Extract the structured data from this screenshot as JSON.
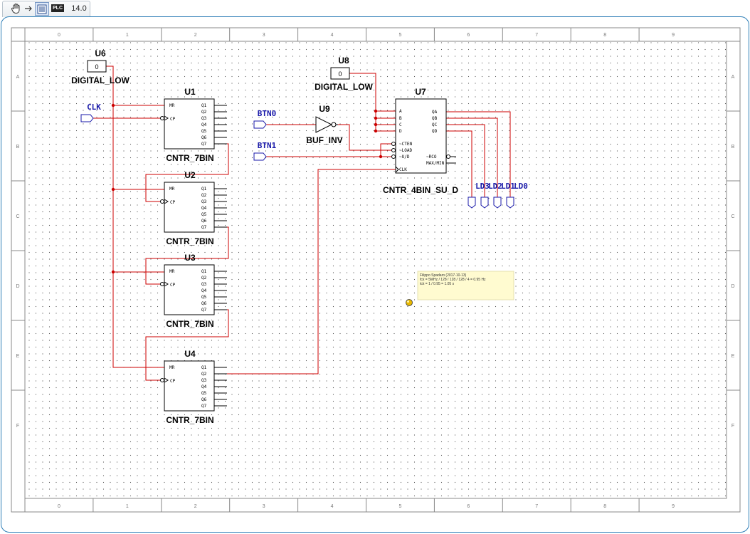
{
  "toolbar": {
    "hand_icon": "hand-icon",
    "arrow_icon": "arrow-right-icon",
    "sheet_icon": "schematic-icon",
    "plc_label": "PLC",
    "zoom": "14.0"
  },
  "border": {
    "columns": [
      "0",
      "1",
      "2",
      "3",
      "4",
      "5",
      "6",
      "7",
      "8",
      "9"
    ],
    "rows": [
      "A",
      "B",
      "C",
      "D",
      "E",
      "F"
    ]
  },
  "components": {
    "u6": {
      "ref": "U6",
      "type": "DIGITAL_LOW",
      "value": "0"
    },
    "u8": {
      "ref": "U8",
      "type": "DIGITAL_LOW",
      "value": "0"
    },
    "u9": {
      "ref": "U9",
      "type": "BUF_INV"
    },
    "u1": {
      "ref": "U1",
      "type": "CNTR_7BIN"
    },
    "u2": {
      "ref": "U2",
      "type": "CNTR_7BIN"
    },
    "u3": {
      "ref": "U3",
      "type": "CNTR_7BIN"
    },
    "u4": {
      "ref": "U4",
      "type": "CNTR_7BIN"
    },
    "u7": {
      "ref": "U7",
      "type": "CNTR_4BIN_SU_D"
    }
  },
  "pins": {
    "cntr7_left": [
      "MR",
      "CP"
    ],
    "cntr7_right": [
      "Q1",
      "Q2",
      "Q3",
      "Q4",
      "Q5",
      "Q6",
      "Q7"
    ],
    "cntr4_left": [
      "A",
      "B",
      "C",
      "D",
      "~CTEN",
      "~LOAD",
      "~U/D",
      "CLK"
    ],
    "cntr4_right": [
      "QA",
      "QB",
      "QC",
      "QD",
      "~RCO",
      "MAX/MIN"
    ]
  },
  "ports": {
    "clk": "CLK",
    "btn0": "BTN0",
    "btn1": "BTN1",
    "outputs": [
      "LD3",
      "LD2",
      "LD1",
      "LD0"
    ]
  },
  "note": {
    "line1": "Filippo Spadaro  (2017-10-13)",
    "line2": "fck = 5MHz / 128 / 128 / 128 / 4 = 0.95 Hz",
    "line3": "tck = 1 / 0.95 = 1.05 s"
  },
  "colors": {
    "wire": "#cc0000",
    "port": "#1a1aaa",
    "border_frame": "#2c7db6",
    "note_bg": "#fffbd0"
  }
}
